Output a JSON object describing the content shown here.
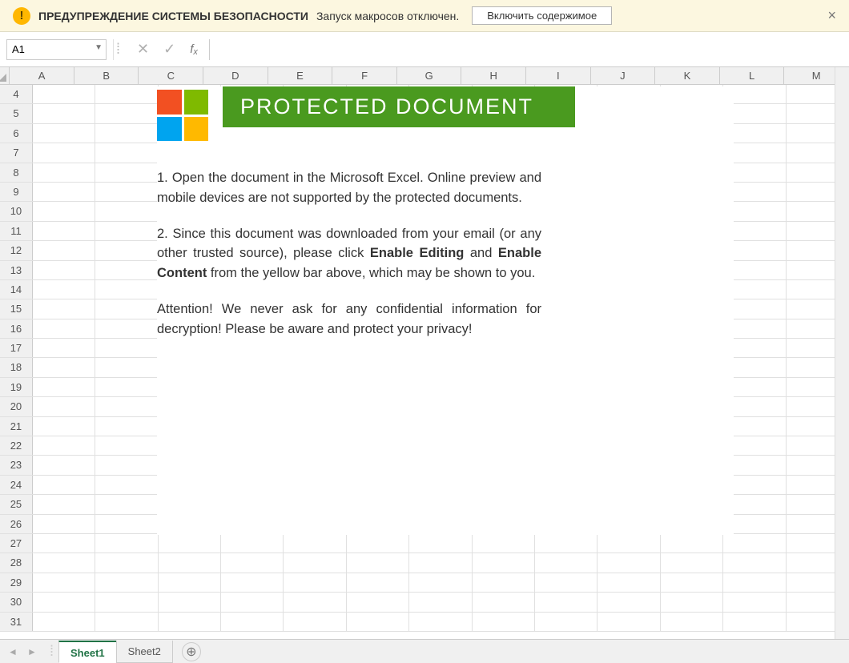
{
  "security_bar": {
    "title": "ПРЕДУПРЕЖДЕНИЕ СИСТЕМЫ БЕЗОПАСНОСТИ",
    "message": "Запуск макросов отключен.",
    "button": "Включить содержимое",
    "close": "×"
  },
  "namebox": {
    "value": "A1"
  },
  "formula_bar": {
    "value": ""
  },
  "columns": [
    "A",
    "B",
    "C",
    "D",
    "E",
    "F",
    "G",
    "H",
    "I",
    "J",
    "K",
    "L",
    "M"
  ],
  "rows": [
    4,
    5,
    6,
    7,
    8,
    9,
    10,
    11,
    12,
    13,
    14,
    15,
    16,
    17,
    18,
    19,
    20,
    21,
    22,
    23,
    24,
    25,
    26,
    27,
    28,
    29,
    30,
    31
  ],
  "lure": {
    "banner": "PROTECTED DOCUMENT",
    "p1": "1. Open the document in the Microsoft Excel. Online preview and mobile devices are not supported by the protected documents.",
    "p2a": "2. Since this document was downloaded from your email (or any other trusted source), please click ",
    "p2b1": "Enable Editing",
    "p2c": " and ",
    "p2b2": "Enable Content",
    "p2d": " from the yellow bar above, which may be shown to you.",
    "p3": "Attention! We never ask for any confidential information for decryption! Please be aware and protect your privacy!"
  },
  "tabs": {
    "sheet1": "Sheet1",
    "sheet2": "Sheet2"
  }
}
